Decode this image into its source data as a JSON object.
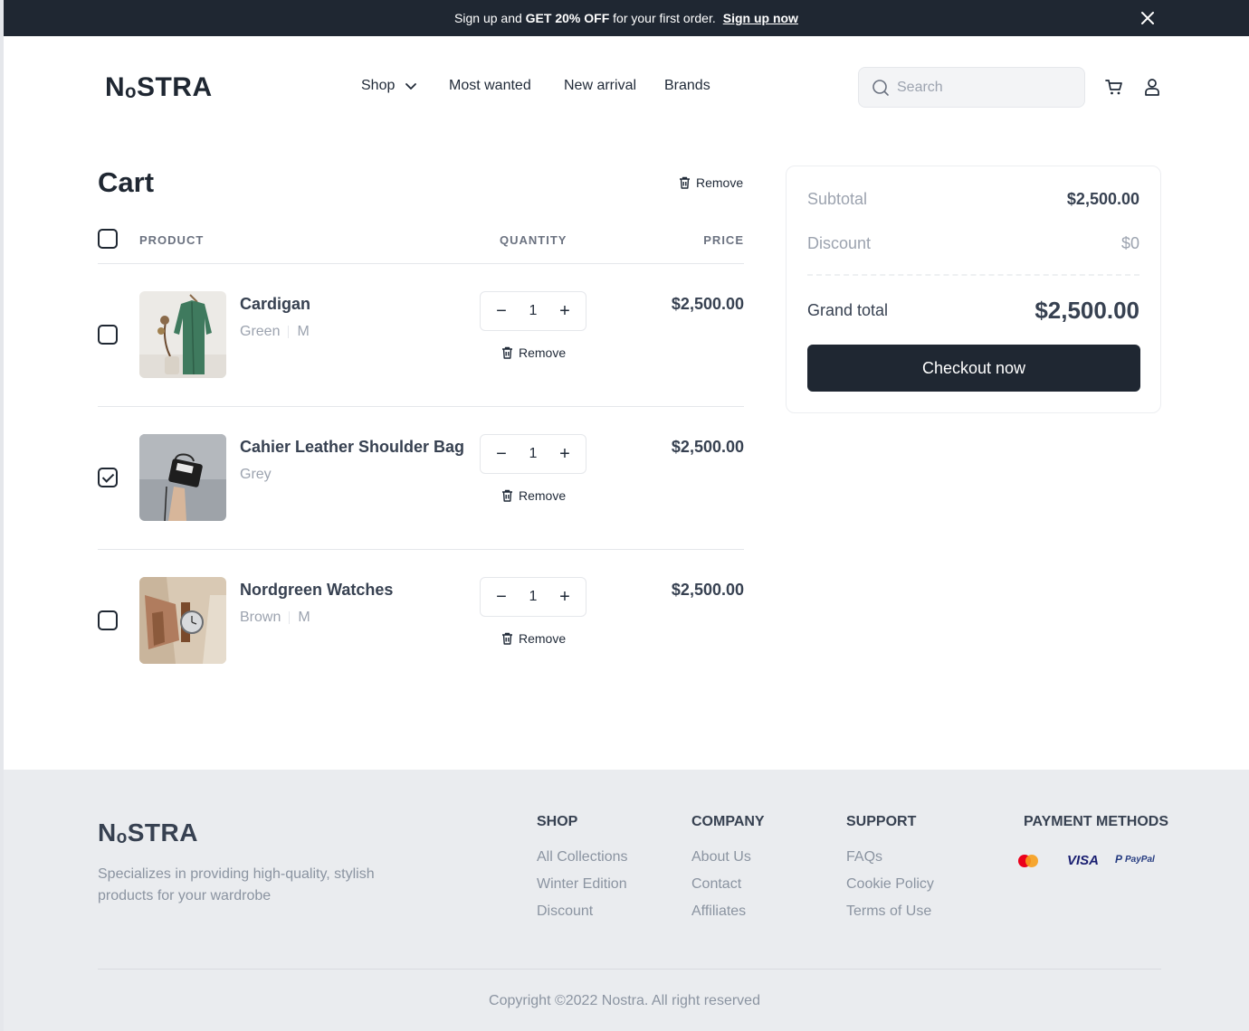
{
  "promo": {
    "text_pre": "Sign up and ",
    "text_bold": "GET 20% OFF",
    "text_post": " for your first order.",
    "link": "Sign up now"
  },
  "header": {
    "logo": "NₒSTRA",
    "nav": [
      "Shop",
      "Most wanted",
      "New arrival",
      "Brands"
    ],
    "search_placeholder": "Search"
  },
  "cart": {
    "title": "Cart",
    "remove_all": "Remove",
    "columns": {
      "product": "PRODUCT",
      "quantity": "QUANTITY",
      "price": "PRICE"
    },
    "items": [
      {
        "name": "Cardigan",
        "color": "Green",
        "size": "M",
        "qty": "1",
        "price": "$2,500.00",
        "remove": "Remove",
        "checked": false
      },
      {
        "name": "Cahier Leather Shoulder Bag",
        "color": "Grey",
        "size": "",
        "qty": "1",
        "price": "$2,500.00",
        "remove": "Remove",
        "checked": true
      },
      {
        "name": "Nordgreen Watches",
        "color": "Brown",
        "size": "M",
        "qty": "1",
        "price": "$2,500.00",
        "remove": "Remove",
        "checked": false
      }
    ]
  },
  "summary": {
    "subtotal_label": "Subtotal",
    "subtotal_value": "$2,500.00",
    "discount_label": "Discount",
    "discount_value": "$0",
    "grand_total_label": "Grand total",
    "grand_total_value": "$2,500.00",
    "checkout_label": "Checkout now"
  },
  "footer": {
    "logo": "NₒSTRA",
    "description": "Specializes in providing high-quality, stylish products for your wardrobe",
    "columns": [
      {
        "title": "SHOP",
        "links": [
          "All Collections",
          "Winter Edition",
          "Discount"
        ]
      },
      {
        "title": "COMPANY",
        "links": [
          "About Us",
          "Contact",
          "Affiliates"
        ]
      },
      {
        "title": "SUPPORT",
        "links": [
          "FAQs",
          "Cookie Policy",
          "Terms of Use"
        ]
      }
    ],
    "payment_title": "PAYMENT METHODS",
    "payment_methods": [
      "mastercard-icon",
      "VISA",
      "PayPal"
    ],
    "copyright": "Copyright ©2022 Nostra. All right reserved"
  },
  "colors": {
    "primary": "#1f2732",
    "muted": "#9ca3af",
    "footer_bg": "#eaecef"
  }
}
